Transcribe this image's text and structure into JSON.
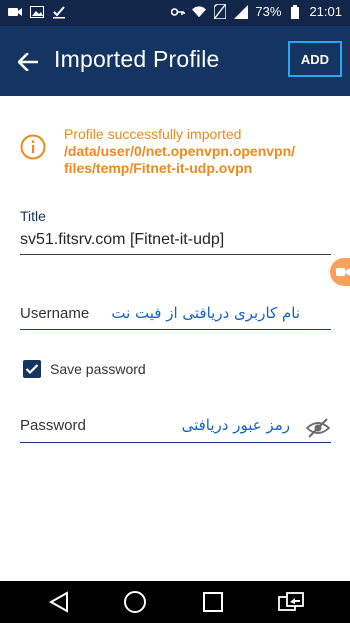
{
  "status_bar": {
    "battery": "73%",
    "time": "21:01",
    "left_icons": [
      "camera-icon",
      "image-icon",
      "check-icon"
    ],
    "right_icons": [
      "key-icon",
      "wifi-icon",
      "no-sim-icon",
      "signal-icon",
      "battery-icon"
    ]
  },
  "app_bar": {
    "title": "Imported Profile",
    "add_label": "ADD",
    "back_icon": "back-arrow-icon"
  },
  "notice": {
    "icon": "info-icon",
    "message": "Profile successfully imported",
    "path_line1": "/data/user/0/net.openvpn.openvpn/",
    "path_line2": "files/temp/Fitnet-it-udp.ovpn"
  },
  "title_field": {
    "label": "Title",
    "value": "sv51.fitsrv.com [Fitnet-it-udp]"
  },
  "username_field": {
    "placeholder": "Username",
    "annotation": "نام کاربری دریافتی از فیت نت"
  },
  "save_password": {
    "label": "Save password",
    "checked": true
  },
  "password_field": {
    "placeholder": "Password",
    "annotation": "رمز عبور دریافتی",
    "toggle_icon": "visibility-off-icon"
  },
  "nav_bar": {
    "icons": [
      "nav-back-icon",
      "nav-home-icon",
      "nav-recents-icon",
      "nav-switch-icon"
    ]
  },
  "colors": {
    "app_bar": "#143461",
    "status_bar": "#12264a",
    "accent_orange": "#f0891c",
    "annotation_blue": "#1565c0",
    "highlight_box": "#2aa7f0"
  }
}
